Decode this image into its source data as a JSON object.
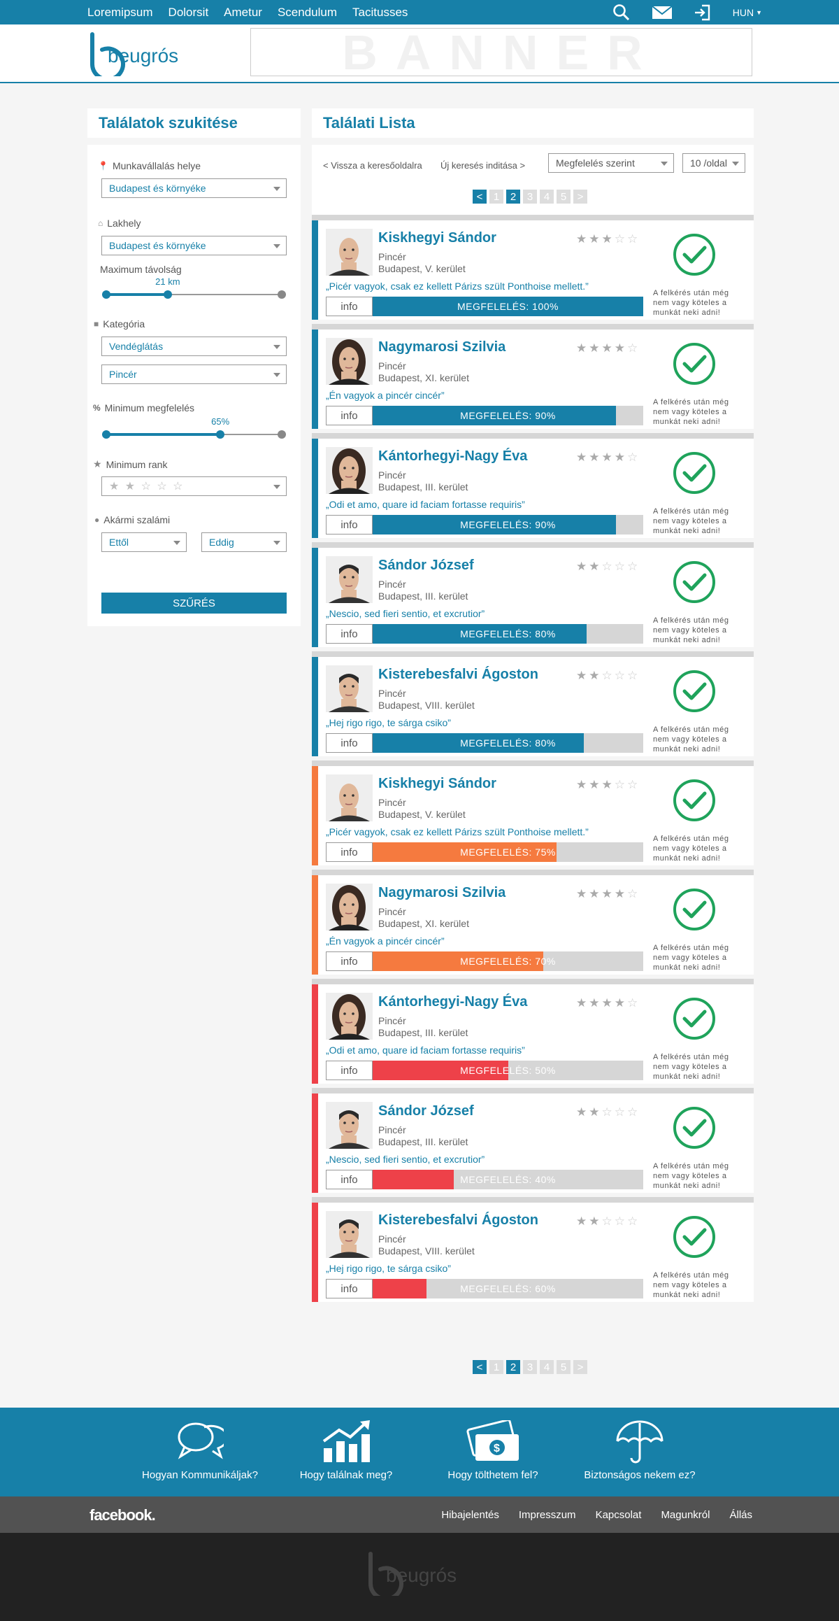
{
  "topnav": {
    "items": [
      "Loremipsum",
      "Dolorsit",
      "Ametur",
      "Scendulum",
      "Tacitusses"
    ],
    "lang": "HUN"
  },
  "header": {
    "logo_text": "beugrós",
    "banner": "BANNER"
  },
  "sidebar": {
    "title": "Találatok szukitése",
    "workplace_label": "Munkavállalás helye",
    "workplace_value": "Budapest és környéke",
    "residence_label": "Lakhely",
    "residence_value": "Budapest és környéke",
    "distance_label": "Maximum távolság",
    "distance_value": "21 km",
    "distance_fraction": 0.35,
    "category_label": "Kategória",
    "category_value": "Vendéglátás",
    "subcategory_value": "Pincér",
    "match_label": "Minimum megfelelés",
    "match_value": "65%",
    "match_fraction": 0.65,
    "rank_label": "Minimum rank",
    "rank_stars": "★ ★ ☆ ☆ ☆",
    "salary_label": "Akármi szalámi",
    "salary_from": "Ettől",
    "salary_to": "Eddig",
    "filter_button": "SZŰRÉS"
  },
  "results": {
    "title": "Találati Lista",
    "back_link": "< Vissza a keresőoldalra",
    "new_search": "Új keresés inditása >",
    "sort_value": "Megfelelés szerint",
    "per_page_value": "10 /oldal",
    "pager": [
      "<",
      "1",
      "2",
      "3",
      "4",
      "5",
      ">"
    ],
    "pager_active": "2",
    "note": "A felkérés után még nem vagy köteles a munkát neki adni!",
    "info_label": "info",
    "cards": [
      {
        "name": "Kiskhegyi Sándor",
        "job": "Pincér",
        "city": "Budapest, V. kerület",
        "quote": "„Picér vagyok, csak ez kellett Párizs szült Ponthoise mellett.”",
        "match_label": "MEGFELELÉS: 100%",
        "match": 1.0,
        "stars": 3,
        "color": "#1780a8"
      },
      {
        "name": "Nagymarosi Szilvia",
        "job": "Pincér",
        "city": "Budapest, XI. kerület",
        "quote": "„Én vagyok a pincér cincér”",
        "match_label": "MEGFELELÉS: 90%",
        "match": 0.9,
        "stars": 4,
        "color": "#1780a8"
      },
      {
        "name": "Kántorhegyi-Nagy Éva",
        "job": "Pincér",
        "city": "Budapest, III. kerület",
        "quote": "„Odi et amo, quare id faciam fortasse requiris”",
        "match_label": "MEGFELELÉS: 90%",
        "match": 0.9,
        "stars": 4,
        "color": "#1780a8"
      },
      {
        "name": "Sándor József",
        "job": "Pincér",
        "city": "Budapest, III. kerület",
        "quote": "„Nescio, sed fieri sentio, et excrutior”",
        "match_label": "MEGFELELÉS: 80%",
        "match": 0.79,
        "stars": 2,
        "color": "#1780a8"
      },
      {
        "name": "Kisterebesfalvi Ágoston",
        "job": "Pincér",
        "city": "Budapest, VIII. kerület",
        "quote": "„Hej rigo rigo, te sárga csiko”",
        "match_label": "MEGFELELÉS: 80%",
        "match": 0.78,
        "stars": 2,
        "color": "#1780a8"
      },
      {
        "name": "Kiskhegyi Sándor",
        "job": "Pincér",
        "city": "Budapest, V. kerület",
        "quote": "„Picér vagyok, csak ez kellett Párizs szült Ponthoise mellett.”",
        "match_label": "MEGFELELÉS: 75%",
        "match": 0.68,
        "stars": 3,
        "color": "#f57a3f"
      },
      {
        "name": "Nagymarosi Szilvia",
        "job": "Pincér",
        "city": "Budapest, XI. kerület",
        "quote": "„Én vagyok a pincér cincér”",
        "match_label": "MEGFELELÉS: 70%",
        "match": 0.63,
        "stars": 4,
        "color": "#f57a3f"
      },
      {
        "name": "Kántorhegyi-Nagy Éva",
        "job": "Pincér",
        "city": "Budapest, III. kerület",
        "quote": "„Odi et amo, quare id faciam fortasse requiris”",
        "match_label": "MEGFELELÉS: 50%",
        "match": 0.5,
        "stars": 4,
        "color": "#ee4149"
      },
      {
        "name": "Sándor József",
        "job": "Pincér",
        "city": "Budapest, III. kerület",
        "quote": "„Nescio, sed fieri sentio, et excrutior”",
        "match_label": "MEGFELELÉS: 40%",
        "match": 0.3,
        "stars": 2,
        "color": "#ee4149"
      },
      {
        "name": "Kisterebesfalvi Ágoston",
        "job": "Pincér",
        "city": "Budapest, VIII. kerület",
        "quote": "„Hej rigo rigo, te sárga csiko”",
        "match_label": "MEGFELELÉS: 60%",
        "match": 0.2,
        "stars": 2,
        "color": "#ee4149"
      }
    ]
  },
  "features": [
    "Hogyan Kommunikáljak?",
    "Hogy találnak meg?",
    "Hogy tölthetem fel?",
    "Biztonságos nekem ez?"
  ],
  "footer": {
    "facebook": "facebook.",
    "links": [
      "Hibajelentés",
      "Impresszum",
      "Kapcsolat",
      "Magunkról",
      "Állás"
    ],
    "logo_text": "beugrós"
  },
  "colors": {
    "primary": "#1780a8",
    "orange": "#f57a3f",
    "red": "#ee4149",
    "check": "#1fa35b"
  }
}
